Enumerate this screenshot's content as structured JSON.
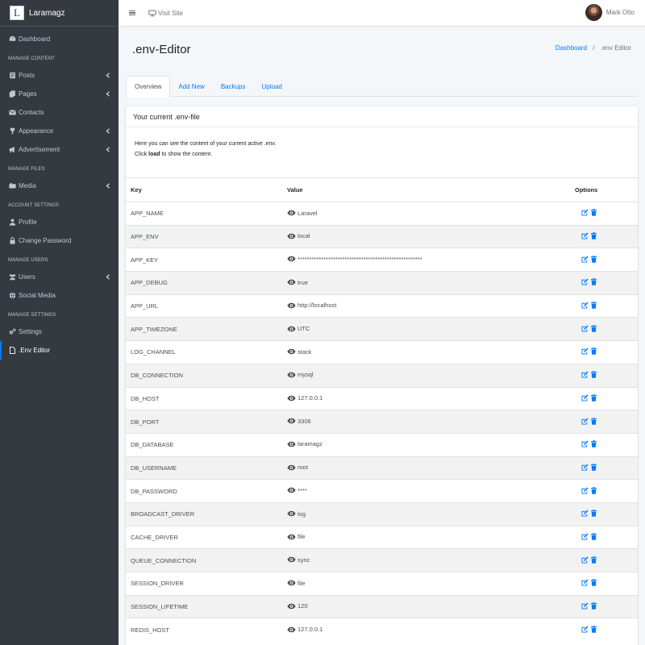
{
  "brand": {
    "name": "Laramagz",
    "logo_letter": "L"
  },
  "sidebar": {
    "items": [
      {
        "label": "Dashboard",
        "icon": "dashboard-icon"
      },
      {
        "header": "MANAGE CONTENT"
      },
      {
        "label": "Posts",
        "icon": "posts-icon",
        "chevron": true
      },
      {
        "label": "Pages",
        "icon": "pages-icon",
        "chevron": true
      },
      {
        "label": "Contacts",
        "icon": "contacts-icon"
      },
      {
        "label": "Appearance",
        "icon": "appearance-icon",
        "chevron": true
      },
      {
        "label": "Advertisement",
        "icon": "advertisement-icon",
        "chevron": true
      },
      {
        "header": "MANAGE FILES"
      },
      {
        "label": "Media",
        "icon": "media-icon",
        "chevron": true
      },
      {
        "header": "ACCOUNT SETTINGS"
      },
      {
        "label": "Profile",
        "icon": "profile-icon"
      },
      {
        "label": "Change Password",
        "icon": "lock-icon"
      },
      {
        "header": "MANAGE USERS"
      },
      {
        "label": "Users",
        "icon": "users-icon",
        "chevron": true
      },
      {
        "label": "Social Media",
        "icon": "globe-icon"
      },
      {
        "header": "MANAGE SETTINGS"
      },
      {
        "label": "Settings",
        "icon": "gears-icon"
      },
      {
        "label": ".Env Editor",
        "icon": "file-icon",
        "active": true
      }
    ]
  },
  "topbar": {
    "visit_site": "Visit Site",
    "user_name": "Mark Otto"
  },
  "page": {
    "title": ".env-Editor"
  },
  "breadcrumb": {
    "home": "Dashboard",
    "separator": "/",
    "current": ".env Editor"
  },
  "tabs": [
    "Overview",
    "Add New",
    "Backups",
    "Upload"
  ],
  "card": {
    "header": "Your current .env-file",
    "line1": "Here you can see the content of your current active .env.",
    "line2_pre": "Click ",
    "line2_bold": "load",
    "line2_post": " to show the content."
  },
  "table": {
    "columns": [
      "Key",
      "Value",
      "Options"
    ],
    "rows": [
      {
        "key": "APP_NAME",
        "value": "Laravel"
      },
      {
        "key": "APP_ENV",
        "value": "local"
      },
      {
        "key": "APP_KEY",
        "value": "*****************************************************"
      },
      {
        "key": "APP_DEBUG",
        "value": "true"
      },
      {
        "key": "APP_URL",
        "value": "http://localhost"
      },
      {
        "key": "APP_TIMEZONE",
        "value": "UTC"
      },
      {
        "key": "LOG_CHANNEL",
        "value": "stack"
      },
      {
        "key": "DB_CONNECTION",
        "value": "mysql"
      },
      {
        "key": "DB_HOST",
        "value": "127.0.0.1"
      },
      {
        "key": "DB_PORT",
        "value": "3306"
      },
      {
        "key": "DB_DATABASE",
        "value": "laramagz"
      },
      {
        "key": "DB_USERNAME",
        "value": "root"
      },
      {
        "key": "DB_PASSWORD",
        "value": "****"
      },
      {
        "key": "BROADCAST_DRIVER",
        "value": "log"
      },
      {
        "key": "CACHE_DRIVER",
        "value": "file"
      },
      {
        "key": "QUEUE_CONNECTION",
        "value": "sync"
      },
      {
        "key": "SESSION_DRIVER",
        "value": "file"
      },
      {
        "key": "SESSION_LIFETIME",
        "value": "120"
      },
      {
        "key": "REDIS_HOST",
        "value": "127.0.0.1"
      }
    ]
  },
  "colors": {
    "sidebar_bg": "#343a40",
    "accent": "#007bff",
    "content_bg": "#f4f6f9"
  }
}
